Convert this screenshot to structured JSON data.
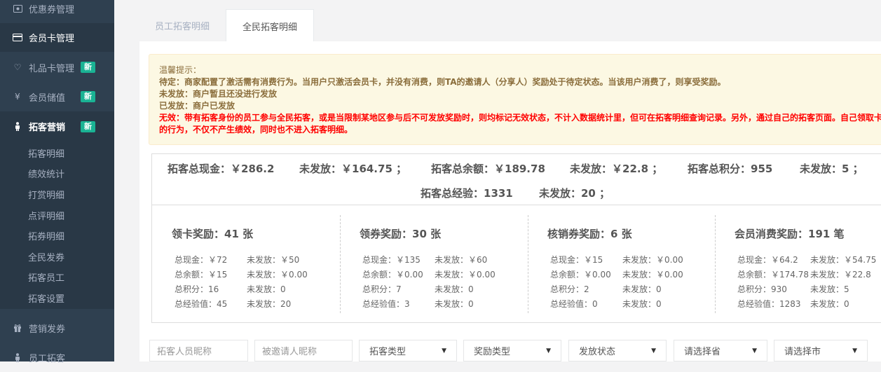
{
  "sidebar": {
    "items": [
      {
        "label": "优惠券管理",
        "icon": "coupon-icon"
      },
      {
        "label": "会员卡管理",
        "icon": "credit-card-icon"
      },
      {
        "label": "礼品卡管理",
        "icon": "heart-icon",
        "badge": "新"
      },
      {
        "label": "会员储值",
        "icon": "yen-icon",
        "badge": "新"
      },
      {
        "label": "拓客营销",
        "icon": "person-icon",
        "badge": "新"
      },
      {
        "label": "营销发券",
        "icon": "gift-icon"
      },
      {
        "label": "员工拓客",
        "icon": "person-icon"
      }
    ],
    "subitems": [
      "拓客明细",
      "绩效统计",
      "打赏明细",
      "点评明细",
      "拓券明细",
      "全民发券",
      "拓客员工",
      "拓客设置"
    ]
  },
  "tabs": [
    {
      "label": "员工拓客明细",
      "active": false
    },
    {
      "label": "全民拓客明细",
      "active": true
    }
  ],
  "tip": {
    "title": "温馨提示：",
    "line1": "待定：商家配置了激活需有消费行为。当用户只激活会员卡，并没有消费，则TA的邀请人（分享人）奖励处于待定状态。当该用户消费了，则享受奖励。",
    "line2": "未发放：商户暂且还没进行发放",
    "line3": "已发放：商户已发放",
    "line4": "无效：带有拓客身份的员工参与全民拓客，或是当限制某地区参与后不可发放奖励时，则均标记无效状态，不计入数据统计里，但可在拓客明细查询记录。另外，通过自己的拓客页面。自己领取卡",
    "line5": "的行为，不仅不产生绩效，同时也不进入拓客明细。"
  },
  "summary": {
    "cash": "拓客总现金：￥286.2",
    "cash_unissued": "未发放：￥164.75 ；",
    "balance": "拓客总余额：￥189.78",
    "balance_unissued": "未发放：￥22.8 ；",
    "points": "拓客总积分：955",
    "points_unissued": "未发放：5 ；",
    "exp": "拓客总经验：1331",
    "exp_unissued": "未发放：20 ；"
  },
  "cards": [
    {
      "title": "领卡奖励：41 张",
      "rows": [
        [
          "总现金：￥72",
          "未发放：￥50"
        ],
        [
          "总余额：￥15",
          "未发放：￥0.00"
        ],
        [
          "总积分：16",
          "未发放：0"
        ],
        [
          "总经验值：45",
          "未发放：20"
        ]
      ]
    },
    {
      "title": "领券奖励：30 张",
      "rows": [
        [
          "总现金：￥135",
          "未发放：￥60"
        ],
        [
          "总余额：￥0.00",
          "未发放：￥0.00"
        ],
        [
          "总积分：7",
          "未发放：0"
        ],
        [
          "总经验值：3",
          "未发放：0"
        ]
      ]
    },
    {
      "title": "核销券奖励：6 张",
      "rows": [
        [
          "总现金：￥15",
          "未发放：￥0.00"
        ],
        [
          "总余额：￥0.00",
          "未发放：￥0.00"
        ],
        [
          "总积分：2",
          "未发放：0"
        ],
        [
          "总经验值：0",
          "未发放：0"
        ]
      ]
    },
    {
      "title": "会员消费奖励：191 笔",
      "rows": [
        [
          "总现金：￥64.2",
          "未发放：￥54.75"
        ],
        [
          "总余额：￥174.78",
          "未发放：￥22.8"
        ],
        [
          "总积分：930",
          "未发放：5"
        ],
        [
          "总经验值：1283",
          "未发放：0"
        ]
      ]
    }
  ],
  "filters": {
    "promoter_placeholder": "拓客人员昵称",
    "invitee_placeholder": "被邀请人昵称",
    "type": "拓客类型",
    "reward_type": "奖励类型",
    "status": "发放状态",
    "province": "请选择省",
    "city": "请选择市"
  },
  "colors": {
    "sidebar_bg": "#2f4050",
    "badge": "#1ab394",
    "tip_bg": "#fcf8e3",
    "invalid_text": "#ff0000"
  }
}
